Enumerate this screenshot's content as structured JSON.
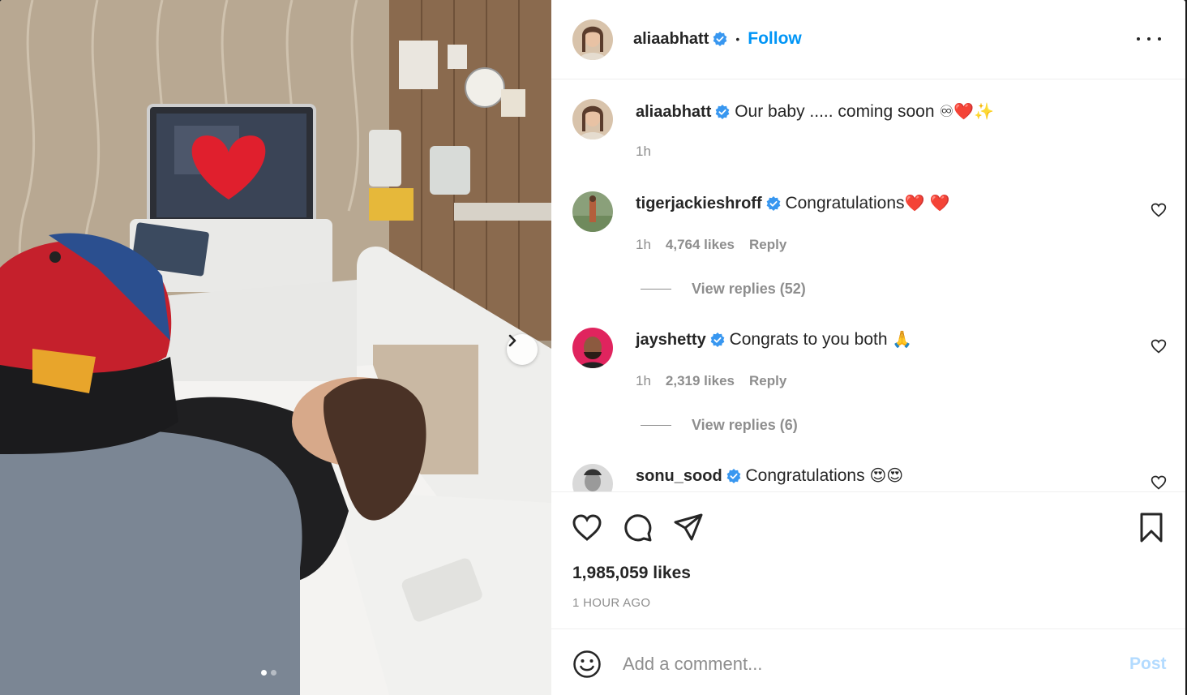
{
  "post": {
    "author": "aliaabhatt",
    "follow_label": "Follow",
    "separator": "•",
    "likes": "1,985,059 likes",
    "time_ago": "1 HOUR AGO",
    "carousel": {
      "slides": 2,
      "active": 1
    }
  },
  "caption": {
    "username": "aliaabhatt",
    "text": "Our baby ..... coming soon",
    "emoji": "♾❤️✨",
    "time": "1h"
  },
  "comments": [
    {
      "username": "tigerjackieshroff",
      "text": "Congratulations",
      "emoji": "❤️ ❤️",
      "time": "1h",
      "likes": "4,764 likes",
      "reply_label": "Reply",
      "view_replies": "View replies (52)"
    },
    {
      "username": "jayshetty",
      "text": "Congrats to you both",
      "emoji": "🙏",
      "time": "1h",
      "likes": "2,319 likes",
      "reply_label": "Reply",
      "view_replies": "View replies (6)"
    },
    {
      "username": "sonu_sood",
      "text": "Congratulations",
      "emoji": "😍😍"
    }
  ],
  "composer": {
    "placeholder": "Add a comment...",
    "post_label": "Post"
  },
  "colors": {
    "accent": "#0095f6",
    "verified": "#3897f0",
    "post_disabled": "#b3dbff",
    "muted": "#8e8e8e"
  },
  "icons": [
    "verified-badge-icon",
    "more-options-icon",
    "like-heart-icon",
    "comment-icon",
    "share-icon",
    "bookmark-icon",
    "emoji-icon",
    "next-arrow-icon"
  ]
}
